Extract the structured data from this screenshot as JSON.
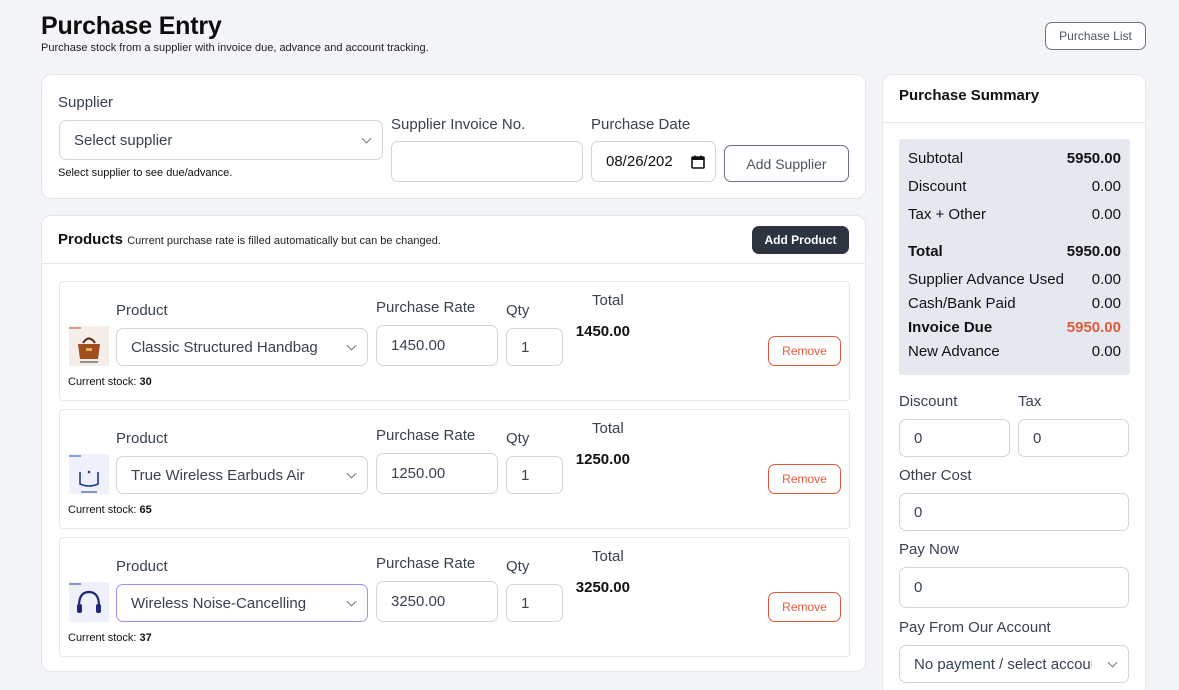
{
  "header": {
    "title": "Purchase Entry",
    "subtitle": "Purchase stock from a supplier with invoice due, advance and account tracking.",
    "purchase_list_label": "Purchase List"
  },
  "supplier_form": {
    "supplier_label": "Supplier",
    "supplier_placeholder": "Select supplier",
    "supplier_hint": "Select supplier to see due/advance.",
    "invoice_label": "Supplier Invoice No.",
    "invoice_value": "",
    "date_label": "Purchase Date",
    "date_value": "08/26/202",
    "add_supplier_label": "Add Supplier"
  },
  "products": {
    "title": "Products",
    "note": "Current purchase rate is filled automatically but can be changed.",
    "add_product_label": "Add Product",
    "product_label": "Product",
    "rate_label": "Purchase Rate",
    "qty_label": "Qty",
    "total_label": "Total",
    "stock_label": "Current stock:",
    "remove_label": "Remove",
    "rows": [
      {
        "name": "Classic Structured Handbag",
        "rate": "1450.00",
        "qty": "1",
        "total": "1450.00",
        "stock": "30",
        "icon": "handbag-icon"
      },
      {
        "name": "True Wireless Earbuds Air",
        "rate": "1250.00",
        "qty": "1",
        "total": "1250.00",
        "stock": "65",
        "icon": "earbuds-icon"
      },
      {
        "name": "Wireless Noise-Cancelling",
        "rate": "3250.00",
        "qty": "1",
        "total": "3250.00",
        "stock": "37",
        "icon": "headphones-icon"
      }
    ]
  },
  "summary": {
    "title": "Purchase Summary",
    "subtotal_label": "Subtotal",
    "subtotal": "5950.00",
    "discount_label": "Discount",
    "discount": "0.00",
    "tax_other_label": "Tax + Other",
    "tax_other": "0.00",
    "total_label": "Total",
    "total": "5950.00",
    "advance_used_label": "Supplier Advance Used",
    "advance_used": "0.00",
    "cash_paid_label": "Cash/Bank Paid",
    "cash_paid": "0.00",
    "invoice_due_label": "Invoice Due",
    "invoice_due": "5950.00",
    "new_advance_label": "New Advance",
    "new_advance": "0.00",
    "discount_input_label": "Discount",
    "discount_input": "0",
    "tax_input_label": "Tax",
    "tax_input": "0",
    "other_cost_label": "Other Cost",
    "other_cost": "0",
    "pay_now_label": "Pay Now",
    "pay_now": "0",
    "pay_account_label": "Pay From Our Account",
    "pay_account_value": "No payment / select account"
  },
  "colors": {
    "accent_dark": "#2d3440",
    "danger": "#e25a3e",
    "focus": "#a78bfa"
  }
}
